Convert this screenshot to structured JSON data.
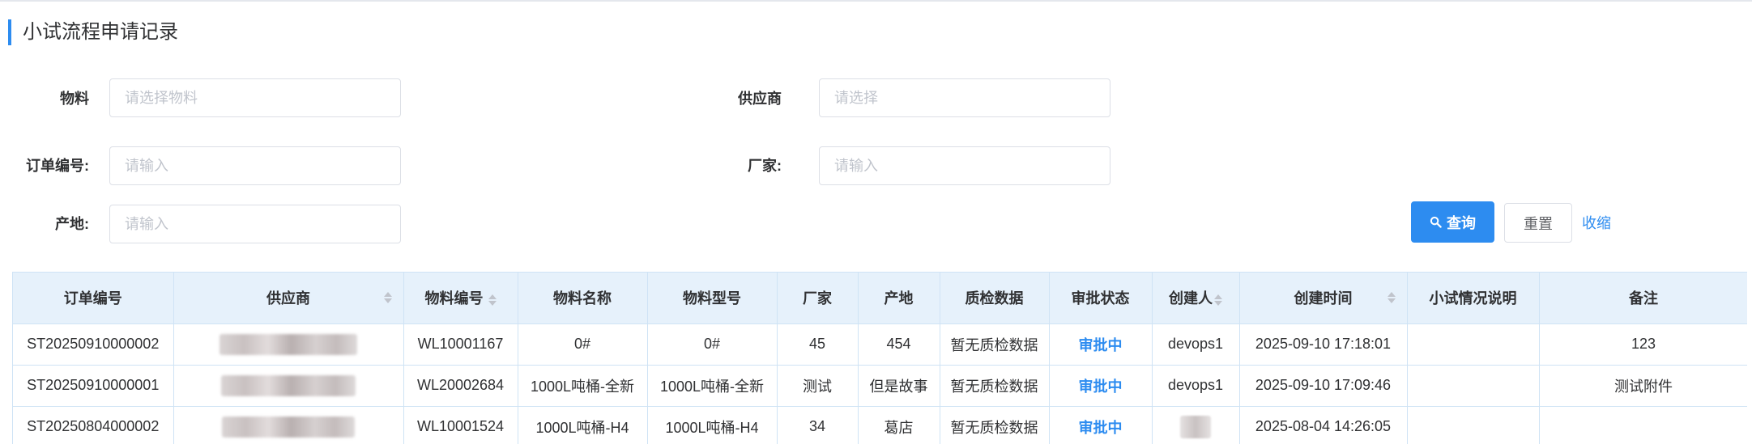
{
  "page": {
    "title": "小试流程申请记录"
  },
  "filters": {
    "material": {
      "label": "物料",
      "placeholder": "请选择物料"
    },
    "supplier": {
      "label": "供应商",
      "placeholder": "请选择"
    },
    "order_no": {
      "label": "订单编号:",
      "placeholder": "请输入"
    },
    "manufacturer": {
      "label": "厂家:",
      "placeholder": "请输入"
    },
    "origin": {
      "label": "产地:",
      "placeholder": "请输入"
    }
  },
  "actions": {
    "query": "查询",
    "reset": "重置",
    "collapse": "收缩"
  },
  "table": {
    "columns": [
      "订单编号",
      "供应商",
      "物料编号",
      "物料名称",
      "物料型号",
      "厂家",
      "产地",
      "质检数据",
      "审批状态",
      "创建人",
      "创建时间",
      "小试情况说明",
      "备注"
    ],
    "rows": [
      {
        "order_no": "ST20250910000002",
        "material_no": "WL10001167",
        "material_name": "0#",
        "material_model": "0#",
        "manufacturer": "45",
        "origin": "454",
        "qc_data": "暂无质检数据",
        "status": "审批中",
        "creator": "devops1",
        "created_at": "2025-09-10 17:18:01",
        "description": "",
        "remark": "123"
      },
      {
        "order_no": "ST20250910000001",
        "material_no": "WL20002684",
        "material_name": "1000L吨桶-全新",
        "material_model": "1000L吨桶-全新",
        "manufacturer": "测试",
        "origin": "但是故事",
        "qc_data": "暂无质检数据",
        "status": "审批中",
        "creator": "devops1",
        "created_at": "2025-09-10 17:09:46",
        "description": "",
        "remark": "测试附件"
      },
      {
        "order_no": "ST20250804000002",
        "material_no": "WL10001524",
        "material_name": "1000L吨桶-H4",
        "material_model": "1000L吨桶-H4",
        "manufacturer": "34",
        "origin": "葛店",
        "qc_data": "暂无质检数据",
        "status": "审批中",
        "creator": "",
        "created_at": "2025-08-04 14:26:05",
        "description": "",
        "remark": ""
      }
    ]
  },
  "colors": {
    "primary": "#2d8cf0",
    "header_bg": "#e6f1fb",
    "border": "#cfe3f5"
  }
}
